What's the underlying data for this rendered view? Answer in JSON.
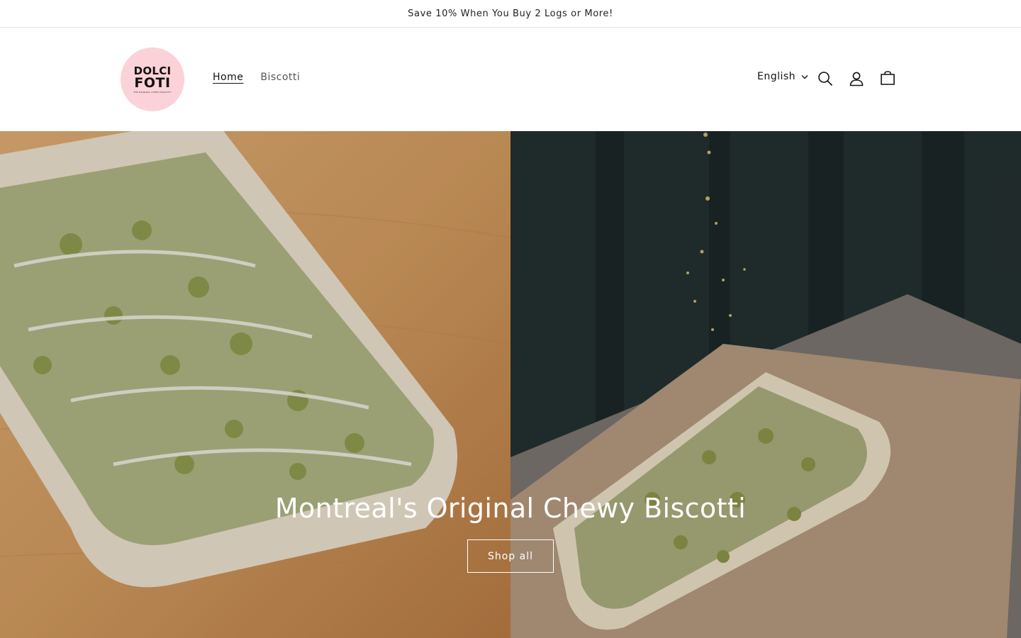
{
  "announcement": {
    "text": "Save 10% When You Buy 2 Logs or More!"
  },
  "header": {
    "logo": {
      "line1": "DOLCI",
      "line2": "FOTI",
      "tagline": "THE ORIGINAL CHEWY BISCOTTI"
    },
    "nav": [
      {
        "label": "Home",
        "active": true
      },
      {
        "label": "Biscotti",
        "active": false
      }
    ],
    "language": {
      "selected": "English"
    },
    "icons": [
      "search-icon",
      "account-icon",
      "cart-icon"
    ]
  },
  "hero": {
    "title": "Montreal's Original Chewy Biscotti",
    "button_label": "Shop all"
  },
  "colors": {
    "logo_background": "#fbd2d7",
    "text": "#121212"
  }
}
